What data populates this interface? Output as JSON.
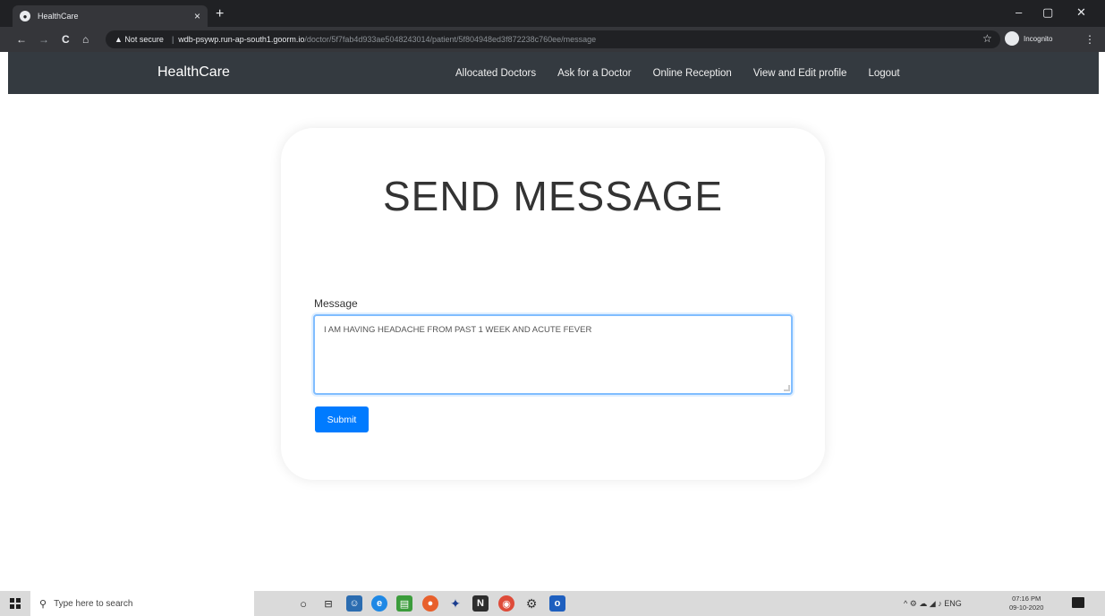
{
  "browser": {
    "tab_title": "HealthCare",
    "tab_close": "×",
    "new_tab": "+",
    "window_controls": {
      "minimize": "–",
      "maximize": "▢",
      "close": "✕"
    },
    "nav": {
      "back": "←",
      "forward": "→",
      "reload": "C",
      "home": "⌂"
    },
    "security_warning": "▲ Not secure",
    "url_host": "wdb-psywp.run-ap-south1.goorm.io",
    "url_path": "/doctor/5f7fab4d933ae5048243014/patient/5f804948ed3f872238c760ee/message",
    "star": "☆",
    "profile_label": "Incognito",
    "menu": "⋮"
  },
  "navbar": {
    "brand": "HealthCare",
    "links": [
      "Allocated Doctors",
      "Ask for a Doctor",
      "Online Reception",
      "View and Edit profile",
      "Logout"
    ]
  },
  "form": {
    "title": "SEND MESSAGE",
    "message_label": "Message",
    "message_value": "I AM HAVING HEADACHE FROM PAST 1 WEEK AND ACUTE FEVER",
    "submit_label": "Submit"
  },
  "taskbar": {
    "search_placeholder": "Type here to search",
    "tray_text": "^ ⚙ ☁ ◢ ♪ ENG",
    "time": "07:16 PM",
    "date": "09-10-2020",
    "colors": {
      "taskbar_bg": "#dadada",
      "accent": "#007bff",
      "navbar_bg": "#343a40"
    }
  }
}
